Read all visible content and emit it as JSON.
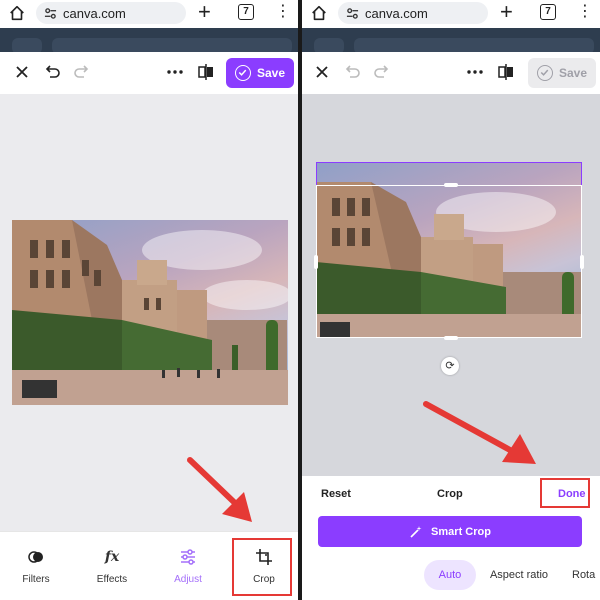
{
  "browser": {
    "url": "canva.com",
    "tab_count": "7"
  },
  "left_panel": {
    "save_label": "Save",
    "tools": [
      {
        "label": "Filters"
      },
      {
        "label": "Effects"
      },
      {
        "label": "Adjust"
      },
      {
        "label": "Crop"
      }
    ]
  },
  "right_panel": {
    "save_label": "Save",
    "crop_bar": {
      "reset_label": "Reset",
      "title": "Crop",
      "done_label": "Done"
    },
    "smart_crop_label": "Smart Crop",
    "ratio_options": [
      {
        "label": "Auto",
        "selected": true
      },
      {
        "label": "Aspect ratio",
        "selected": false
      },
      {
        "label": "Rota",
        "selected": false
      }
    ]
  },
  "colors": {
    "accent": "#8b3dff",
    "highlight": "#e53935",
    "arrow": "#e53935"
  },
  "icons": {
    "home": "home-icon",
    "site_settings": "tune-icon",
    "new_tab": "plus-icon",
    "menu": "kebab-icon",
    "close": "close-icon",
    "undo": "undo-icon",
    "redo": "redo-icon",
    "more": "more-horizontal-icon",
    "compare": "compare-icon",
    "save_check": "check-circle-icon",
    "filters": "filters-icon",
    "effects": "fx-icon",
    "adjust": "sliders-icon",
    "crop": "crop-icon",
    "rotate": "rotate-icon",
    "smart_crop": "magic-wand-icon"
  }
}
